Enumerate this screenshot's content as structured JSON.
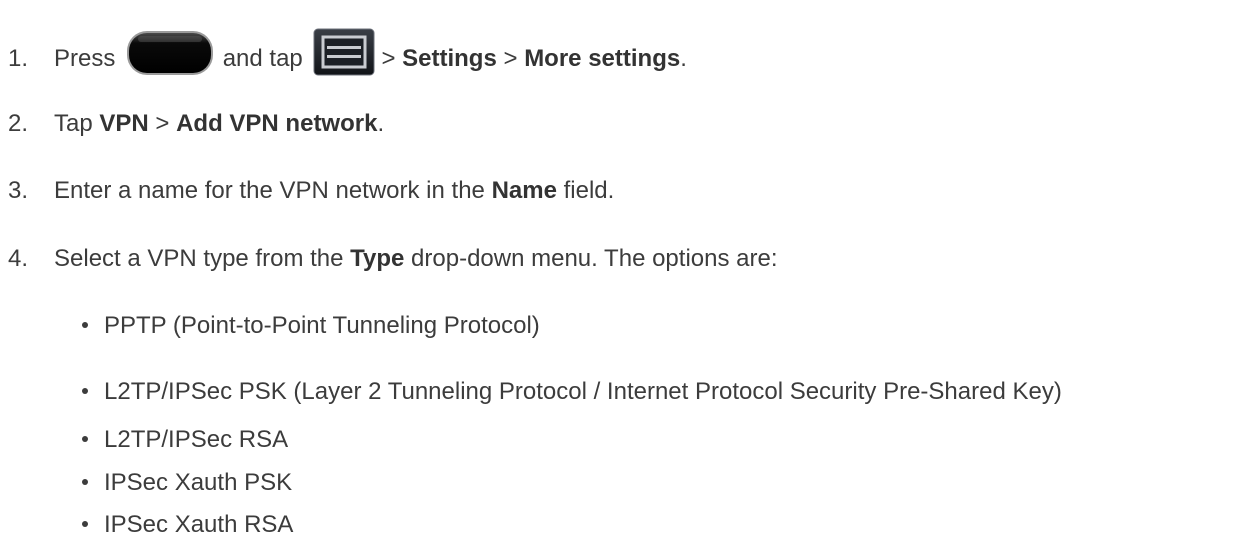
{
  "steps": [
    {
      "number": "1.",
      "t1": "Press",
      "t2": "and tap",
      "t3": ">",
      "b1": "Settings",
      "t4": ">",
      "b2": "More settings",
      "t5": ".",
      "icons": [
        "home-key-icon",
        "menu-key-icon"
      ]
    },
    {
      "number": "2.",
      "t1": "Tap",
      "b1": "VPN",
      "t2": ">",
      "b2": "Add VPN network",
      "t3": "."
    },
    {
      "number": "3.",
      "t1": "Enter a name for the VPN network in the",
      "b1": "Name",
      "t2": "field."
    },
    {
      "number": "4.",
      "t1": "Select a VPN type from the",
      "b1": "Type",
      "t2": "drop-down menu. The options are:"
    }
  ],
  "vpn_types": [
    "PPTP (Point-to-Point Tunneling Protocol)",
    "L2TP/IPSec PSK (Layer 2 Tunneling Protocol / Internet Protocol Security Pre-Shared Key)",
    "L2TP/IPSec RSA",
    "IPSec Xauth PSK",
    "IPSec Xauth RSA"
  ]
}
